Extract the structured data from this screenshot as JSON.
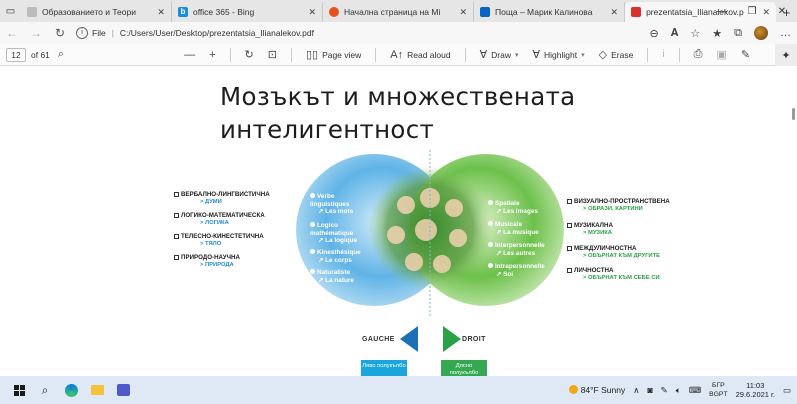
{
  "browser": {
    "tabs": [
      {
        "title": "Образованието и Теори",
        "favicon": "page-icon",
        "active": false
      },
      {
        "title": "office 365 - Bing",
        "favicon": "bing-icon",
        "active": false
      },
      {
        "title": "Начална страница на Mi",
        "favicon": "office-icon",
        "active": false
      },
      {
        "title": "Поща – Марик Калинова",
        "favicon": "outlook-icon",
        "active": false
      },
      {
        "title": "prezentatsia_Ilianalekov.p",
        "favicon": "pdf-icon",
        "active": true
      }
    ],
    "address": {
      "protocol_label": "File",
      "url": "C:/Users/User/Desktop/prezentatsia_Ilianalekov.pdf"
    }
  },
  "pdf_toolbar": {
    "page_current": "12",
    "page_total": "of 61",
    "page_view": "Page view",
    "read_aloud": "Read aloud",
    "draw": "Draw",
    "highlight": "Highlight",
    "erase": "Erase"
  },
  "slide": {
    "title_line1": "Мозъкът и множествената",
    "title_line2": "интелигентност",
    "left_labels": [
      {
        "label": "ВЕРБАЛНО-ЛИНГВИСТИЧНА",
        "sub": "ДУМИ"
      },
      {
        "label": "ЛОГИКО-МАТЕМАТИЧЕСКА",
        "sub": "ЛОГИКА"
      },
      {
        "label": "ТЕЛЕСНО-КИНЕСТЕТИЧНА",
        "sub": "ТЯЛО"
      },
      {
        "label": "ПРИРОДО-НАУЧНА",
        "sub": "ПРИРОДА"
      }
    ],
    "right_labels": [
      {
        "label": "ВИЗУАЛНО-ПРОСТРАНСТВЕНА",
        "sub": "ОБРАЗИ, КАРТИНИ"
      },
      {
        "label": "МУЗИКАЛНА",
        "sub": "МУЗИКА"
      },
      {
        "label": "МЕЖДУЛИЧНОСТНА",
        "sub": "ОБЪРНАТ КЪМ ДРУГИТЕ"
      },
      {
        "label": "ЛИЧНОСТНА",
        "sub": "ОБЪРНАТ КЪМ СЕБЕ СИ"
      }
    ],
    "left_french": [
      {
        "main": "Verbe linguistiques",
        "sub": "Les mots"
      },
      {
        "main": "Logico mathématique",
        "sub": "La logique"
      },
      {
        "main": "Kinesthésique",
        "sub": "Le corps"
      },
      {
        "main": "Naturaliste",
        "sub": "La nature"
      }
    ],
    "right_french": [
      {
        "main": "Spatiale",
        "sub": "Les images"
      },
      {
        "main": "Musicale",
        "sub": "La musique"
      },
      {
        "main": "Interpersonnelle",
        "sub": "Les autres"
      },
      {
        "main": "Intrapersonnelle",
        "sub": "Soi"
      }
    ],
    "gauche": "GAUCHE",
    "droit": "DROIT",
    "left_button": "Ляво полукълбо",
    "right_button": "Дясно полукълбо",
    "colors": {
      "left_blue": "#1e8bd0",
      "right_green": "#2aa146"
    }
  },
  "taskbar": {
    "weather": "84°F  Sunny",
    "lang_top": "БГР",
    "lang_bottom": "BGPT",
    "time": "11:03",
    "date": "29.6.2021 г."
  }
}
